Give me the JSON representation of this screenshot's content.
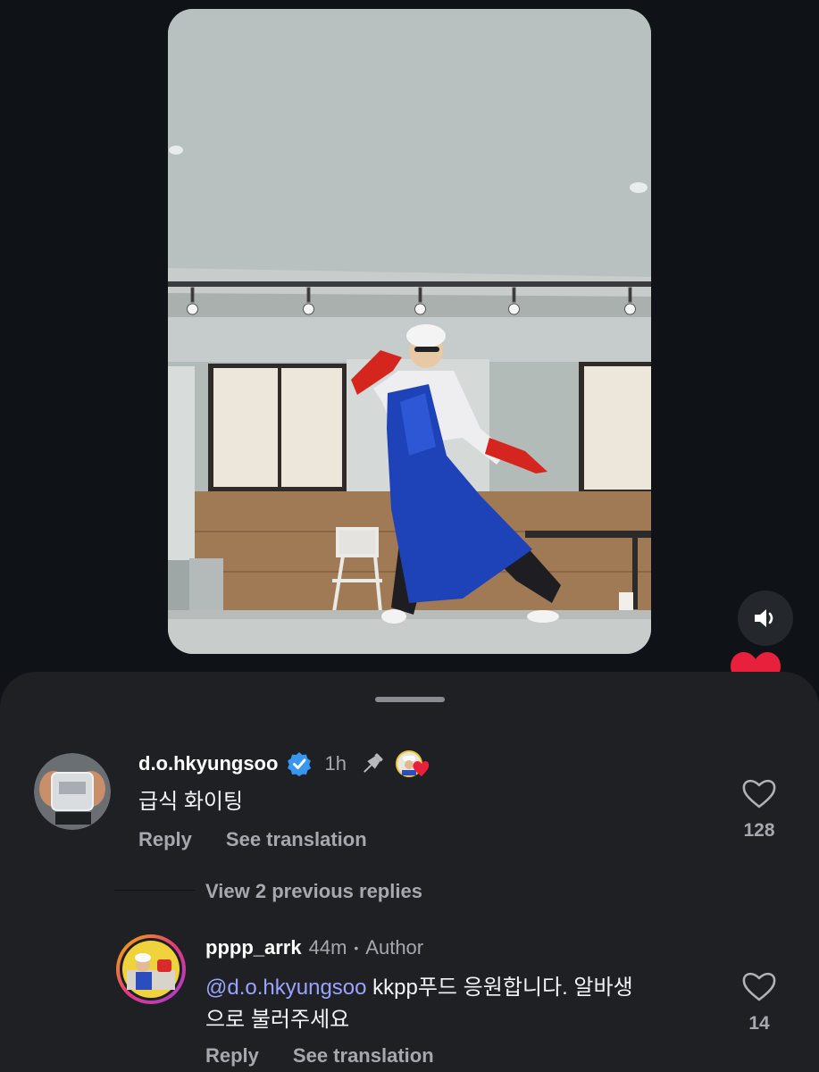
{
  "post": {
    "media_kind": "video"
  },
  "comment": {
    "username": "d.o.hkyungsoo",
    "time": "1h",
    "text": "급식 화이팅",
    "reply_label": "Reply",
    "translate_label": "See translation",
    "like_count": "128"
  },
  "replies_toggle": "View 2 previous replies",
  "reply": {
    "username": "pppp_arrk",
    "time": "44m",
    "separator": "•",
    "author_badge": "Author",
    "mention": "@d.o.hkyungsoo",
    "text_line1": " kkpp푸드 응원합니다. 알바생",
    "text_line2": "으로 불러주세요",
    "reply_label": "Reply",
    "translate_label": "See translation",
    "like_count": "14"
  },
  "colors": {
    "background": "#0f1216",
    "sheet": "#1f2024",
    "verified": "#3797f0",
    "accent_heart": "#e8203b",
    "mention": "#9aa3ff"
  },
  "icons": [
    "volume-icon",
    "heart-icon",
    "verified-badge-icon",
    "pin-icon",
    "creator-liked-icon",
    "like-heart-icon"
  ]
}
